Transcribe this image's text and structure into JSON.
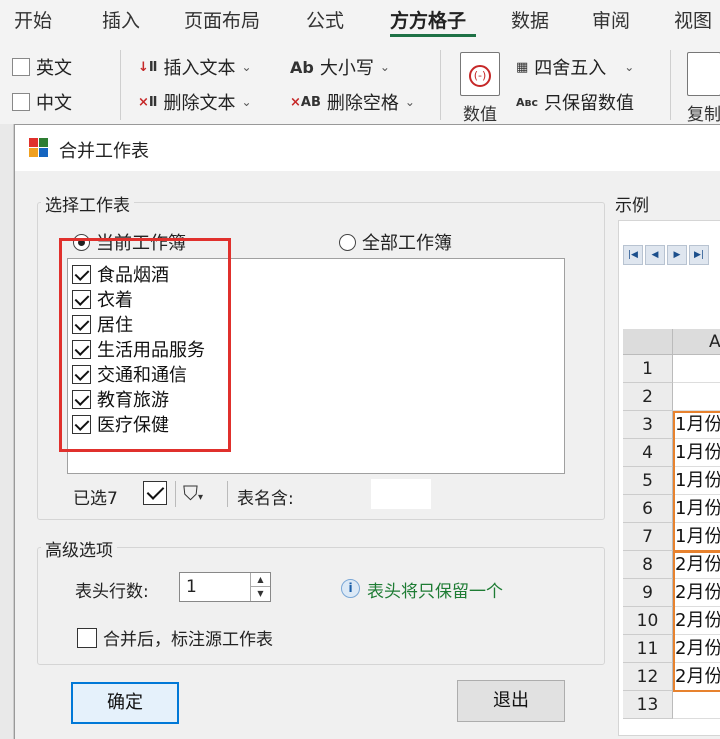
{
  "ribbon_tabs": [
    "开始",
    "插入",
    "页面布局",
    "公式",
    "方方格子",
    "数据",
    "审阅",
    "视图"
  ],
  "active_tab": "方方格子",
  "ribbon": {
    "chk_english": "英文",
    "chk_chinese": "中文",
    "insert_text": "插入文本",
    "delete_text": "删除文本",
    "case": "大小写",
    "delete_space": "删除空格",
    "numeric": "数值",
    "round": "四舍五入",
    "keep_numeric": "只保留数值",
    "copy": "复制"
  },
  "dialog": {
    "title": "合并工作表",
    "select_group": "选择工作表",
    "radio_current": "当前工作簿",
    "radio_all": "全部工作簿",
    "sheets": [
      "食品烟酒",
      "衣着",
      "居住",
      "生活用品服务",
      "交通和通信",
      "教育旅游",
      "医疗保健"
    ],
    "selected_count": "已选7",
    "name_contains_label": "表名含:",
    "advanced_group": "高级选项",
    "header_rows_label": "表头行数:",
    "header_rows_value": "1",
    "info_text": "表头将只保留一个",
    "mark_source_label": "合并后，标注源工作表",
    "ok_label": "确定",
    "exit_label": "退出",
    "example_label": "示例",
    "example_col": "A",
    "example_rows": [
      "1",
      "2",
      "3",
      "4",
      "5",
      "6",
      "7",
      "8",
      "9",
      "10",
      "11",
      "12",
      "13"
    ],
    "example_cells": [
      "",
      "",
      "1月份",
      "1月份",
      "1月份",
      "1月份",
      "1月份",
      "2月份",
      "2月份",
      "2月份",
      "2月份",
      "2月份",
      ""
    ]
  },
  "colors": {
    "accent_tab": "#1e7145",
    "highlight_box": "#e0302c",
    "example_outline": "#e7822e",
    "primary_border": "#0078d7"
  }
}
